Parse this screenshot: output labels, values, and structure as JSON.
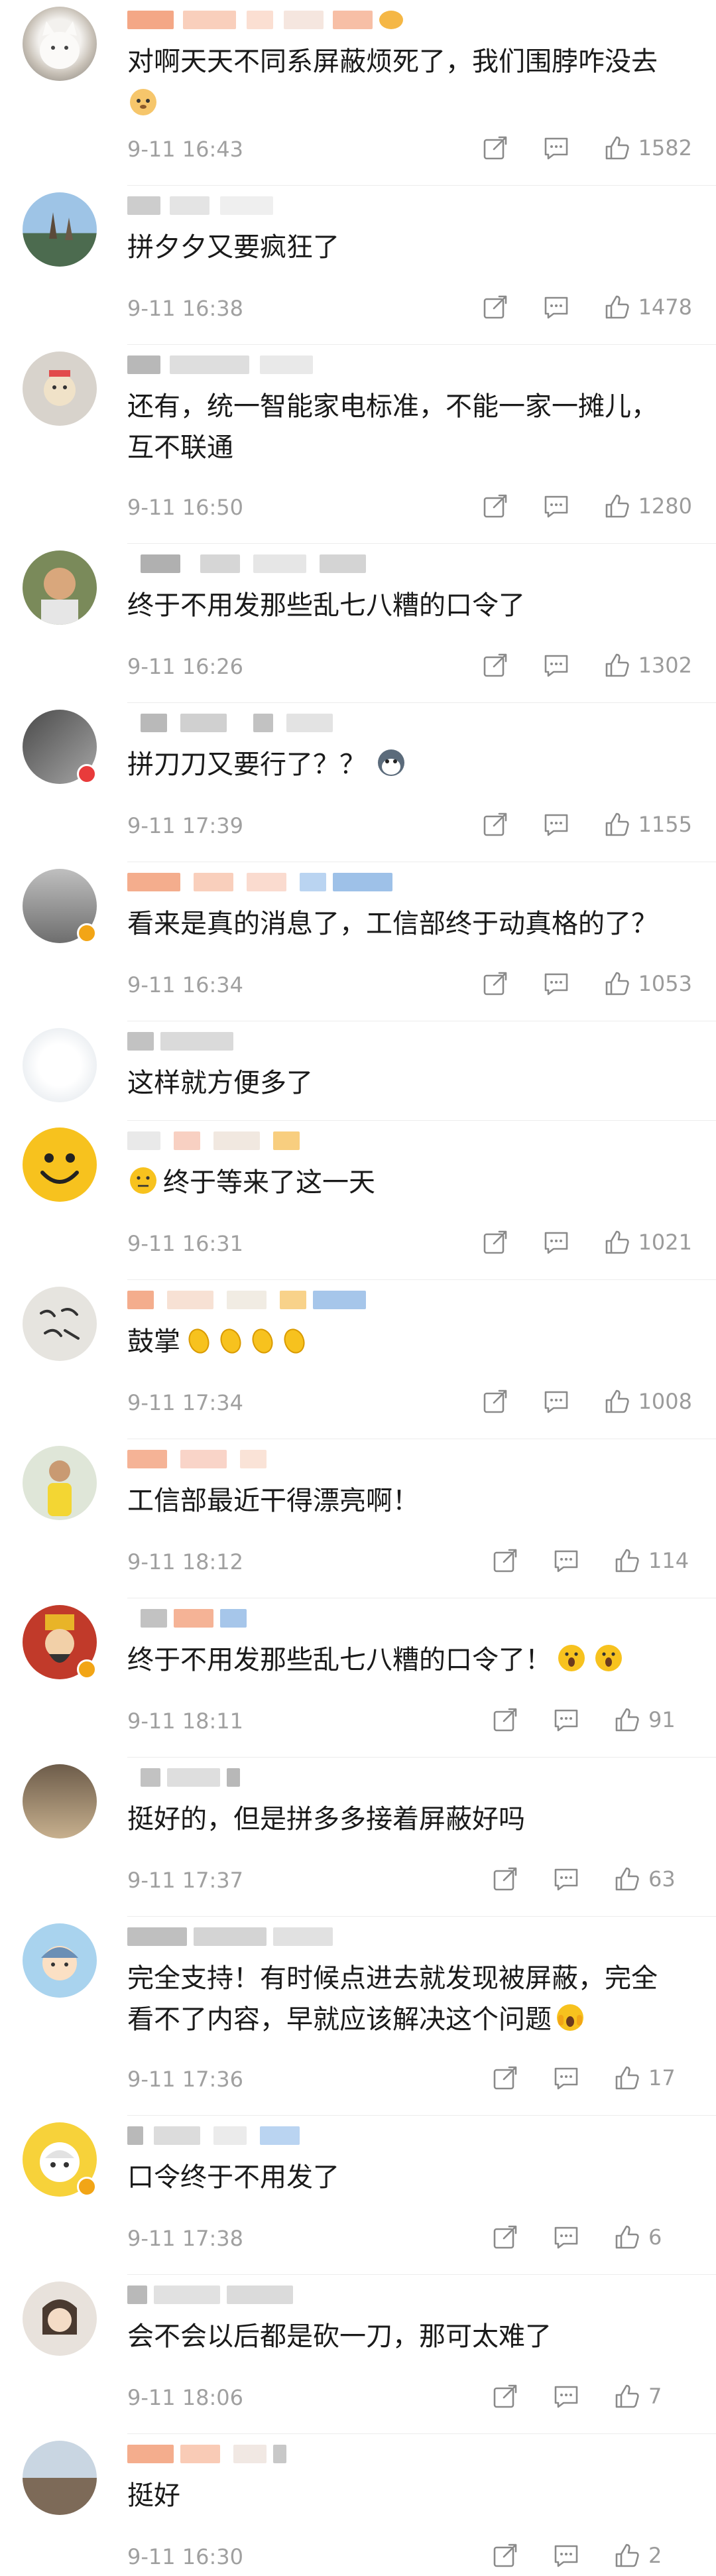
{
  "colors": {
    "accent": "#f2a516",
    "text": "#1a1a1a",
    "meta": "#a0a0a0",
    "divider": "#ececec"
  },
  "icons": {
    "share": "share-icon",
    "comment": "comment-icon",
    "like": "like-icon"
  },
  "comments": [
    {
      "text": "对啊天天不同系屏蔽烦死了，我们围脖咋没去",
      "time": "9-11 16:43",
      "likes": "1582",
      "emoji": "dog-emoji"
    },
    {
      "text": "拼夕夕又要疯狂了",
      "time": "9-11 16:38",
      "likes": "1478"
    },
    {
      "text": "还有，统一智能家电标准，不能一家一摊儿，互不联通",
      "time": "9-11 16:50",
      "likes": "1280"
    },
    {
      "text": "终于不用发那些乱七八糟的口令了",
      "time": "9-11 16:26",
      "likes": "1302"
    },
    {
      "text": "拼刀刀又要行了？？",
      "time": "9-11 17:39",
      "likes": "1155",
      "emoji": "husky-emoji"
    },
    {
      "text": "看来是真的消息了，工信部终于动真格的了？",
      "time": "9-11 16:34",
      "likes": "1053"
    },
    {
      "text": "这样就方便多了",
      "time": "",
      "likes": ""
    },
    {
      "text": "终于等来了这一天",
      "time": "9-11 16:31",
      "likes": "1021",
      "emoji": "thinking-emoji"
    },
    {
      "text": "鼓掌",
      "time": "9-11 17:34",
      "likes": "1008",
      "emoji": "clap-emoji"
    },
    {
      "text": "工信部最近干得漂亮啊！",
      "time": "9-11 18:12",
      "likes": "114"
    },
    {
      "text": "终于不用发那些乱七八糟的口令了！",
      "time": "9-11 18:11",
      "likes": "91",
      "emoji": "shocked-emoji"
    },
    {
      "text": "挺好的，但是拼多多接着屏蔽好吗",
      "time": "9-11 17:37",
      "likes": "63"
    },
    {
      "text": "完全支持！有时候点进去就发现被屏蔽，完全看不了内容，早就应该解决这个问题",
      "time": "9-11 17:36",
      "likes": "17",
      "emoji": "scream-emoji"
    },
    {
      "text": "口令终于不用发了",
      "time": "9-11 17:38",
      "likes": "6"
    },
    {
      "text": "会不会以后都是砍一刀，那可太难了",
      "time": "9-11 18:06",
      "likes": "7"
    },
    {
      "text": "挺好",
      "time": "9-11 16:30",
      "likes": "2"
    }
  ]
}
